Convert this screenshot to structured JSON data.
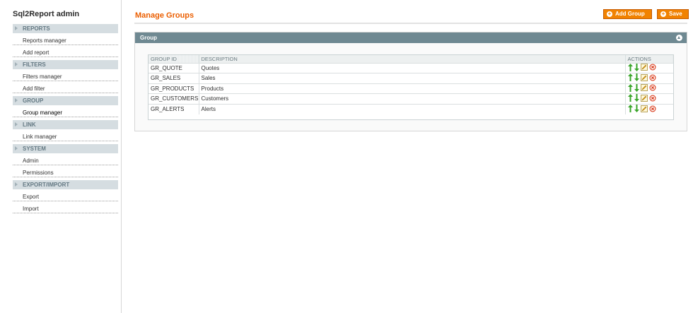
{
  "app": {
    "title": "Sql2Report admin"
  },
  "sidebar": {
    "sections": [
      {
        "label": "REPORTS",
        "items": [
          "Reports manager",
          "Add report"
        ]
      },
      {
        "label": "FILTERS",
        "items": [
          "Filters manager",
          "Add filter"
        ]
      },
      {
        "label": "GROUP",
        "items": [
          "Group manager"
        ]
      },
      {
        "label": "LINK",
        "items": [
          "Link manager"
        ]
      },
      {
        "label": "SYSTEM",
        "items": [
          "Admin",
          "Permissions"
        ]
      },
      {
        "label": "EXPORT/IMPORT",
        "items": [
          "Export",
          "Import"
        ]
      }
    ]
  },
  "header": {
    "title": "Manage Groups",
    "add_label": "Add Group",
    "save_label": "Save"
  },
  "panel": {
    "title": "Group",
    "table": {
      "columns": [
        "GROUP ID",
        "DESCRIPTION",
        "ACTIONS"
      ],
      "rows": [
        {
          "id": "GR_QUOTE",
          "description": "Quotes"
        },
        {
          "id": "GR_SALES",
          "description": "Sales"
        },
        {
          "id": "GR_PRODUCTS",
          "description": "Products"
        },
        {
          "id": "GR_CUSTOMERS",
          "description": "Customers"
        },
        {
          "id": "GR_ALERTS",
          "description": "Alerts"
        }
      ]
    }
  },
  "colors": {
    "accent": "#eb5e00",
    "button": "#f18200",
    "panel_header": "#6f8992",
    "section_bg": "#d5dde1",
    "up_arrow": "#3aa52a",
    "delete": "#d93a1a"
  },
  "icons": {
    "move_up": "arrow-up-icon",
    "move_down": "arrow-down-icon",
    "edit": "edit-icon",
    "delete": "delete-icon"
  }
}
